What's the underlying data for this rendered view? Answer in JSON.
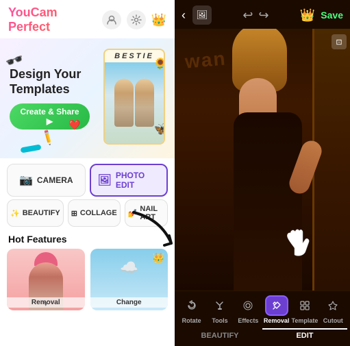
{
  "leftPanel": {
    "appLogo": "YouCam Perfect",
    "banner": {
      "title": "Design Your Templates",
      "createBtnLabel": "Create & Share ▶",
      "bestieLabel": "BESTIE"
    },
    "gridButtons": [
      {
        "id": "camera",
        "label": "CAMERA",
        "icon": "📷",
        "active": false
      },
      {
        "id": "photo-edit",
        "label": "PHOTO EDIT",
        "icon": "🖼",
        "active": true
      }
    ],
    "gridButtons2": [
      {
        "id": "beautify",
        "label": "BEAUTIFY",
        "icon": "✨",
        "active": false
      },
      {
        "id": "collage",
        "label": "COLLAGE",
        "icon": "⊞",
        "active": false
      },
      {
        "id": "nail",
        "label": "NAIL ART",
        "icon": "💅",
        "active": false
      }
    ],
    "hotFeaturesTitle": "Hot Features",
    "features": [
      {
        "id": "removal1",
        "label": "Removal",
        "hasCrown": false
      },
      {
        "id": "change",
        "label": "Change",
        "hasCrown": true
      }
    ]
  },
  "rightPanel": {
    "saveLabel": "Save",
    "crownIcon": "👑",
    "tools": [
      {
        "id": "rotate",
        "label": "Rotate",
        "icon": "↻",
        "active": false
      },
      {
        "id": "tools",
        "label": "Tools",
        "icon": "⚙",
        "active": false
      },
      {
        "id": "effects",
        "label": "Effects",
        "icon": "✦",
        "active": false
      },
      {
        "id": "removal",
        "label": "Removal",
        "icon": "✂",
        "active": true
      },
      {
        "id": "template",
        "label": "Template",
        "icon": "⊞",
        "active": false
      },
      {
        "id": "cutout",
        "label": "Cutout",
        "icon": "⬡",
        "active": false
      }
    ],
    "tabs": [
      {
        "id": "beautify-tab",
        "label": "BEAUTIFY",
        "active": false
      },
      {
        "id": "edit-tab",
        "label": "EDIT",
        "active": true
      }
    ]
  }
}
